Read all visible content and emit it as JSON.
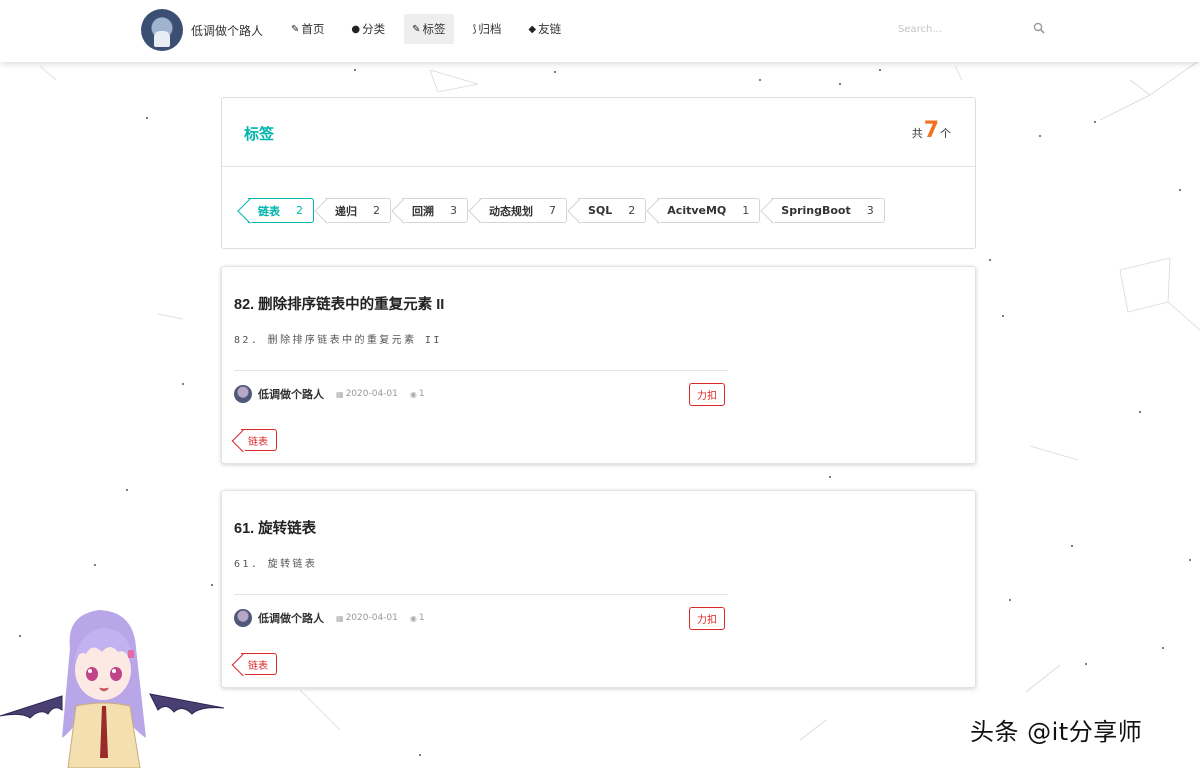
{
  "site": {
    "author_name": "低调做个路人"
  },
  "nav": {
    "items": [
      {
        "icon": "pencil-icon",
        "glyph": "✎",
        "label": "首页"
      },
      {
        "icon": "bulb-icon",
        "glyph": "●",
        "label": "分类"
      },
      {
        "icon": "tags-icon",
        "glyph": "✎",
        "label": "标签",
        "active": true
      },
      {
        "icon": "rss-icon",
        "glyph": "⟆",
        "label": "归档"
      },
      {
        "icon": "fish-icon",
        "glyph": "◆",
        "label": "友链"
      }
    ]
  },
  "search": {
    "placeholder": "Search..."
  },
  "tags_panel": {
    "title": "标签",
    "count_prefix": "共",
    "count": "7",
    "count_suffix": "个",
    "tags": [
      {
        "name": "链表",
        "count": "2",
        "active": true
      },
      {
        "name": "递归",
        "count": "2"
      },
      {
        "name": "回溯",
        "count": "3"
      },
      {
        "name": "动态规划",
        "count": "7"
      },
      {
        "name": "SQL",
        "count": "2"
      },
      {
        "name": "AcitveMQ",
        "count": "1"
      },
      {
        "name": "SpringBoot",
        "count": "3"
      }
    ]
  },
  "posts": [
    {
      "title": "82. 删除排序链表中的重复元素 II",
      "excerpt": "82. 删除排序链表中的重复元素 II",
      "author": "低调做个路人",
      "date": "2020-04-01",
      "views": "1",
      "category": "力扣",
      "tag": "链表"
    },
    {
      "title": "61. 旋转链表",
      "excerpt": "61. 旋转链表",
      "author": "低调做个路人",
      "date": "2020-04-01",
      "views": "1",
      "category": "力扣",
      "tag": "链表"
    }
  ],
  "watermark": "头条 @it分享师",
  "colors": {
    "accent_teal": "#00b5ad",
    "count_orange": "#f2711c",
    "category_red": "#db2828"
  }
}
